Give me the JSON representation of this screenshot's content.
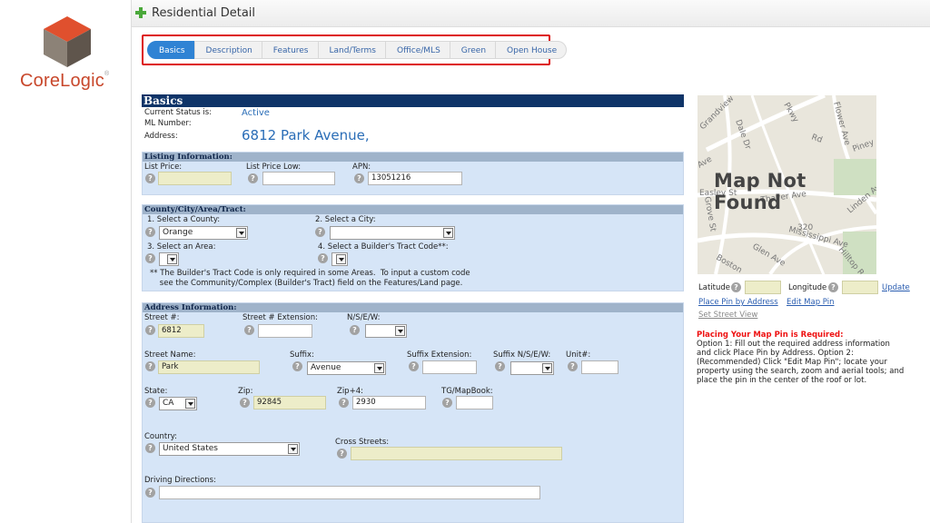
{
  "logo": {
    "name": "CoreLogic",
    "mark": "®"
  },
  "header": {
    "title": "Residential Detail"
  },
  "tabs": [
    {
      "label": "Basics",
      "active": true
    },
    {
      "label": "Description"
    },
    {
      "label": "Features"
    },
    {
      "label": "Land/Terms"
    },
    {
      "label": "Office/MLS"
    },
    {
      "label": "Green"
    },
    {
      "label": "Open House"
    }
  ],
  "basics": {
    "title": "Basics",
    "current_status_label": "Current Status is:",
    "current_status_value": "Active",
    "ml_number_label": "ML Number:",
    "address_label": "Address:",
    "address_value": "6812 Park Avenue,"
  },
  "listing": {
    "title": "Listing Information:",
    "list_price_label": "List Price:",
    "list_price_low_label": "List Price Low:",
    "apn_label": "APN:",
    "apn_value": "13051216"
  },
  "county": {
    "title": "County/City/Area/Tract:",
    "select_county_label": "1. Select a County:",
    "county_value": "Orange",
    "select_city_label": "2. Select a City:",
    "select_area_label": "3. Select an Area:",
    "select_tract_label": "4. Select a Builder's Tract Code**:",
    "note": "** The Builder's Tract Code is only required in some Areas.  To input a custom code\n    see the Community/Complex (Builder's Tract) field on the Features/Land page."
  },
  "address": {
    "title": "Address Information:",
    "street_no_label": "Street #:",
    "street_no_value": "6812",
    "street_ext_label": "Street # Extension:",
    "nsew_label": "N/S/E/W:",
    "street_name_label": "Street Name:",
    "street_name_value": "Park",
    "suffix_label": "Suffix:",
    "suffix_value": "Avenue",
    "suffix_ext_label": "Suffix Extension:",
    "suffix_nsew_label": "Suffix N/S/E/W:",
    "unit_label": "Unit#:",
    "state_label": "State:",
    "state_value": "CA",
    "zip_label": "Zip:",
    "zip_value": "92845",
    "zip4_label": "Zip+4:",
    "zip4_value": "2930",
    "tg_label": "TG/MapBook:",
    "country_label": "Country:",
    "country_value": "United States",
    "cross_label": "Cross Streets:",
    "driving_label": "Driving Directions:"
  },
  "map": {
    "not_found": "Map Not Found",
    "streets": [
      "Grandview",
      "Dale Dr",
      "Pkwy",
      "Flower Ave",
      "Rd",
      "Piney",
      "Thayer Ave",
      "Grove St",
      "Mississippi Ave",
      "Hilltop Rd",
      "Boston",
      "Glen Ave",
      "Ave",
      "320",
      "Linden Ave",
      "Easley St"
    ],
    "latitude_label": "Latitude",
    "longitude_label": "Longitude",
    "update_link": "Update",
    "place_pin_link": "Place Pin by Address",
    "edit_pin_link": "Edit Map Pin",
    "street_view_link": "Set Street View",
    "warning": "Placing Your Map Pin is Required:",
    "instructions": "Option 1: Fill out the required address information and click Place Pin by Address. Option 2: (Recommended) Click \"Edit Map Pin\"; locate your property using the search, zoom and aerial tools; and place the pin in the center of the roof or lot."
  },
  "colors": {
    "accent": "#2f83d4",
    "header": "#0f3468",
    "panel": "#d6e5f7",
    "required": "#ededc9",
    "brand": "#c8472b",
    "warning": "#ee1111"
  }
}
